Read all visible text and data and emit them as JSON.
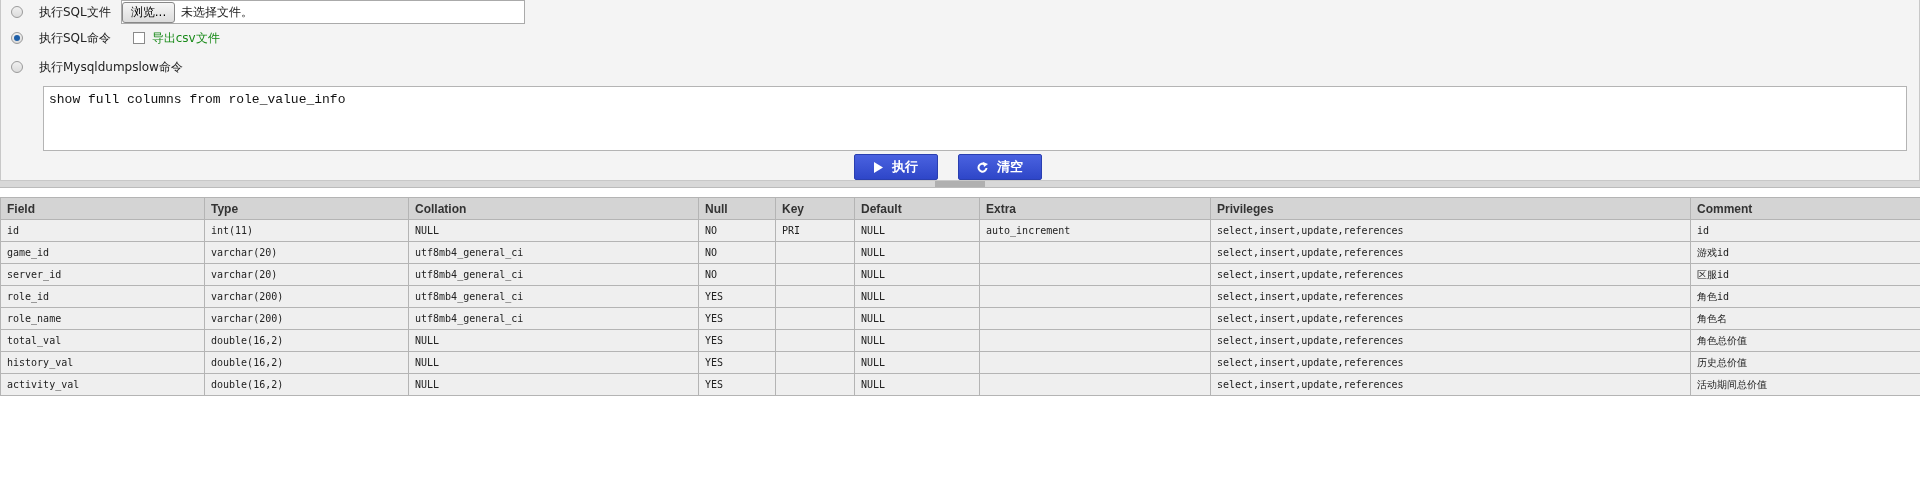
{
  "modes": [
    {
      "kind": "file",
      "label": "执行SQL文件",
      "selected": false,
      "browse_button": "浏览...",
      "file_status": "未选择文件。"
    },
    {
      "kind": "sql",
      "label": "执行SQL命令",
      "selected": true,
      "export": {
        "label": "导出csv文件",
        "checked": false
      }
    },
    {
      "kind": "dumpslow",
      "label": "执行Mysqldumpslow命令",
      "selected": false
    }
  ],
  "query": {
    "value": "show full columns from role_value_info"
  },
  "buttons": [
    {
      "kind": "run",
      "label": "执行"
    },
    {
      "kind": "clear",
      "label": "清空"
    }
  ],
  "table": {
    "columns": [
      "Field",
      "Type",
      "Collation",
      "Null",
      "Key",
      "Default",
      "Extra",
      "Privileges",
      "Comment"
    ],
    "rows": [
      [
        "id",
        "int(11)",
        "NULL",
        "NO",
        "PRI",
        "NULL",
        "auto_increment",
        "select,insert,update,references",
        "id"
      ],
      [
        "game_id",
        "varchar(20)",
        "utf8mb4_general_ci",
        "NO",
        "",
        "NULL",
        "",
        "select,insert,update,references",
        "游戏id"
      ],
      [
        "server_id",
        "varchar(20)",
        "utf8mb4_general_ci",
        "NO",
        "",
        "NULL",
        "",
        "select,insert,update,references",
        "区服id"
      ],
      [
        "role_id",
        "varchar(200)",
        "utf8mb4_general_ci",
        "YES",
        "",
        "NULL",
        "",
        "select,insert,update,references",
        "角色id"
      ],
      [
        "role_name",
        "varchar(200)",
        "utf8mb4_general_ci",
        "YES",
        "",
        "NULL",
        "",
        "select,insert,update,references",
        "角色名"
      ],
      [
        "total_val",
        "double(16,2)",
        "NULL",
        "YES",
        "",
        "NULL",
        "",
        "select,insert,update,references",
        "角色总价值"
      ],
      [
        "history_val",
        "double(16,2)",
        "NULL",
        "YES",
        "",
        "NULL",
        "",
        "select,insert,update,references",
        "历史总价值"
      ],
      [
        "activity_val",
        "double(16,2)",
        "NULL",
        "YES",
        "",
        "NULL",
        "",
        "select,insert,update,references",
        "活动期间总价值"
      ]
    ]
  }
}
